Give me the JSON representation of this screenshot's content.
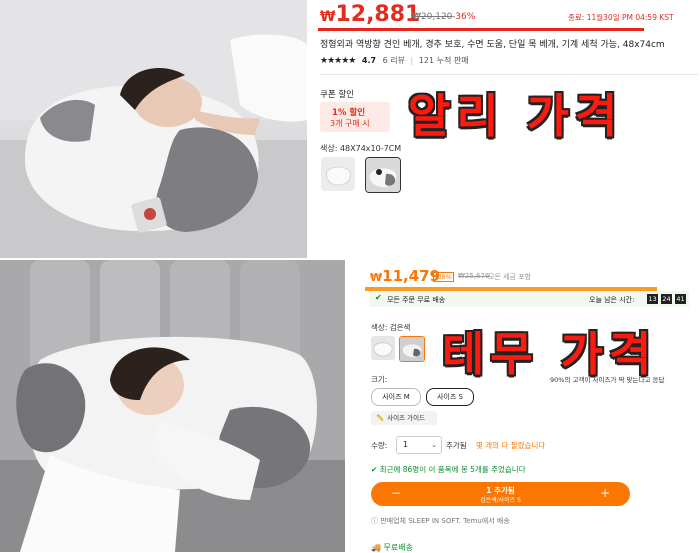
{
  "ali": {
    "price_symbol": "₩",
    "price": "12,881",
    "original_price": "₩20,120",
    "discount": "-36%",
    "promo_time": "종료: 11월30일 PM 04:59 KST",
    "title": "정형외과 역방향 견인 베개, 경추 보호, 수면 도움, 단일 목 베개, 기계 세척 가능, 48x74cm",
    "stars": "★★★★★",
    "rating": "4.7",
    "reviews": "6 리뷰",
    "sold": "121 누적 판매",
    "coupon_label": "쿠폰 할인",
    "coupon_discount": "1% 할인",
    "coupon_condition": "3개 구매 시",
    "color_label": "색상: 48X74x10-7CM",
    "overlay": "알리 가격"
  },
  "temu": {
    "price_symbol": "₩",
    "price": "11,479",
    "discount_badge": "-38%",
    "original_price": "₩25,676",
    "tax_note": "모든 세금 포함",
    "free_shipping_all": "모든 주문 무료 배송",
    "time_left_label": "오늘 남은 시간:",
    "time": [
      "13",
      "24",
      "41"
    ],
    "color_label": "색상: 검은색",
    "size_label": "크기:",
    "size_note": "90%의 고객이 사이즈가 딱 맞는다고 응답",
    "sizes": [
      "사이즈 M",
      "사이즈 S"
    ],
    "size_guide": "사이즈 가이드",
    "qty_label": "수량:",
    "qty_value": "1",
    "stock_label": "추가됨",
    "stock_warning": "몇 개의 다 팔렸습니다",
    "cart_note": "최근에 86명이 이 품목에 봉 5개를 주었습니다",
    "cart_button_main": "1 추가됨",
    "cart_button_sub": "검은색/사이즈 S",
    "seller_note": "판매업체 SLEEP IN SOFT. Temu에서 배송",
    "free_shipping": "무료배송",
    "overlay": "테무 가격"
  }
}
